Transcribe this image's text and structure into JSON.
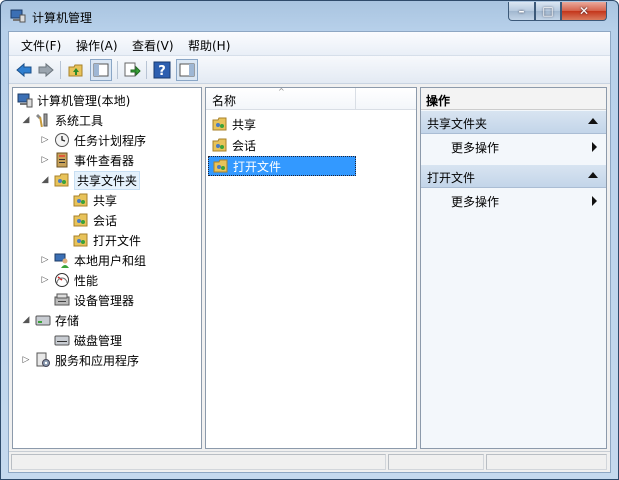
{
  "window": {
    "title": "计算机管理"
  },
  "window_controls": {
    "minimize": "–",
    "maximize": "□",
    "close": "✕"
  },
  "menu": [
    {
      "label": "文件(F)"
    },
    {
      "label": "操作(A)"
    },
    {
      "label": "查看(V)"
    },
    {
      "label": "帮助(H)"
    }
  ],
  "toolbar": [
    {
      "name": "back-icon"
    },
    {
      "name": "forward-icon"
    },
    {
      "name": "up-folder-icon"
    },
    {
      "name": "show-hide-tree-icon"
    },
    {
      "name": "export-list-icon"
    },
    {
      "name": "help-icon"
    },
    {
      "name": "show-hide-action-pane-icon"
    }
  ],
  "tree": [
    {
      "label": "计算机管理(本地)",
      "icon": "computer-management-icon",
      "expander": ""
    },
    {
      "label": "系统工具",
      "icon": "system-tools-icon",
      "expander": "◢"
    },
    {
      "label": "任务计划程序",
      "icon": "task-scheduler-icon",
      "expander": "▷"
    },
    {
      "label": "事件查看器",
      "icon": "event-viewer-icon",
      "expander": "▷"
    },
    {
      "label": "共享文件夹",
      "icon": "shared-folder-icon",
      "expander": "◢"
    },
    {
      "label": "共享",
      "icon": "shares-icon",
      "expander": ""
    },
    {
      "label": "会话",
      "icon": "sessions-icon",
      "expander": ""
    },
    {
      "label": "打开文件",
      "icon": "open-files-icon",
      "expander": ""
    },
    {
      "label": "本地用户和组",
      "icon": "local-users-icon",
      "expander": "▷"
    },
    {
      "label": "性能",
      "icon": "performance-icon",
      "expander": "▷"
    },
    {
      "label": "设备管理器",
      "icon": "device-manager-icon",
      "expander": ""
    },
    {
      "label": "存储",
      "icon": "storage-icon",
      "expander": "◢"
    },
    {
      "label": "磁盘管理",
      "icon": "disk-management-icon",
      "expander": ""
    },
    {
      "label": "服务和应用程序",
      "icon": "services-apps-icon",
      "expander": "▷"
    }
  ],
  "list": {
    "column_header": "名称",
    "sort_indicator": "^",
    "items": [
      {
        "label": "共享"
      },
      {
        "label": "会话"
      },
      {
        "label": "打开文件"
      }
    ]
  },
  "actions": {
    "title": "操作",
    "sections": [
      {
        "header": "共享文件夹",
        "item": "更多操作"
      },
      {
        "header": "打开文件",
        "item": "更多操作"
      }
    ]
  },
  "colors": {
    "selection": "#3399ff",
    "titlebar": "#b7d0ea",
    "action_header": "#c3d5e9"
  }
}
